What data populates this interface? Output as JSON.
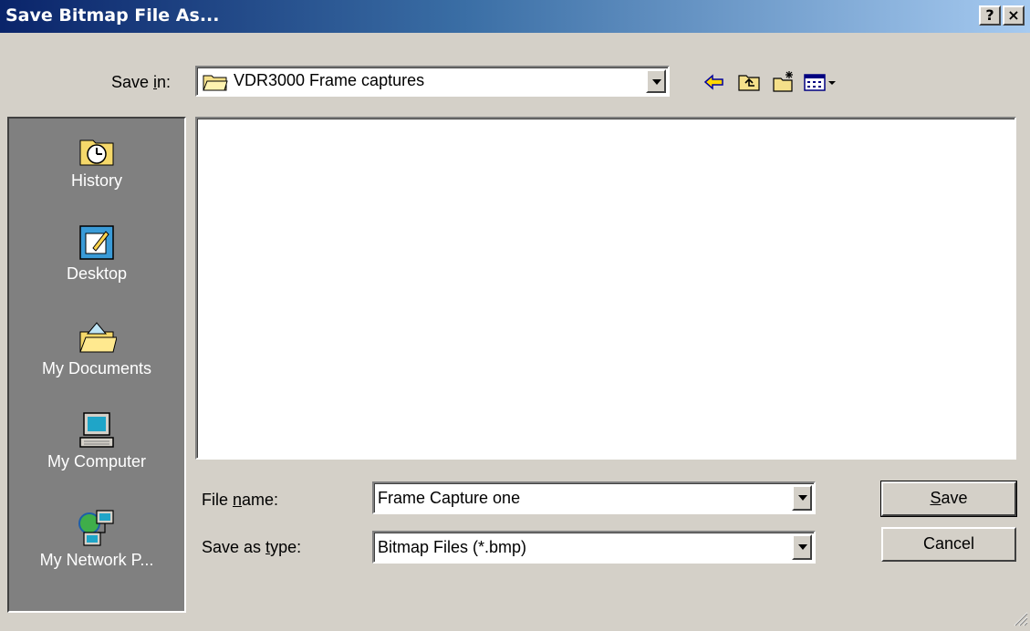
{
  "window": {
    "title": "Save Bitmap File As...",
    "help_label": "?",
    "close_label": "×"
  },
  "save_in": {
    "label_pre": "Save ",
    "label_u": "i",
    "label_post": "n:",
    "value": "VDR3000 Frame captures"
  },
  "toolbar": {
    "icons": [
      "back-arrow-icon",
      "up-one-level-icon",
      "create-new-folder-icon",
      "view-menu-icon"
    ]
  },
  "places": [
    {
      "label": "History",
      "icon": "history-icon"
    },
    {
      "label": "Desktop",
      "icon": "desktop-icon"
    },
    {
      "label": "My Documents",
      "icon": "my-documents-icon"
    },
    {
      "label": "My Computer",
      "icon": "my-computer-icon"
    },
    {
      "label": "My Network P...",
      "icon": "my-network-places-icon"
    }
  ],
  "file_name": {
    "label_pre": "File ",
    "label_u": "n",
    "label_post": "ame:",
    "value": "Frame Capture one"
  },
  "save_as_type": {
    "label_pre": "Save as ",
    "label_u": "t",
    "label_post": "ype:",
    "value": "Bitmap Files (*.bmp)"
  },
  "buttons": {
    "save_u": "S",
    "save_rest": "ave",
    "cancel": "Cancel"
  },
  "colors": {
    "title_start": "#0a246a",
    "title_end": "#a6caf0",
    "face": "#d4d0c8",
    "places_bg": "#808080"
  }
}
